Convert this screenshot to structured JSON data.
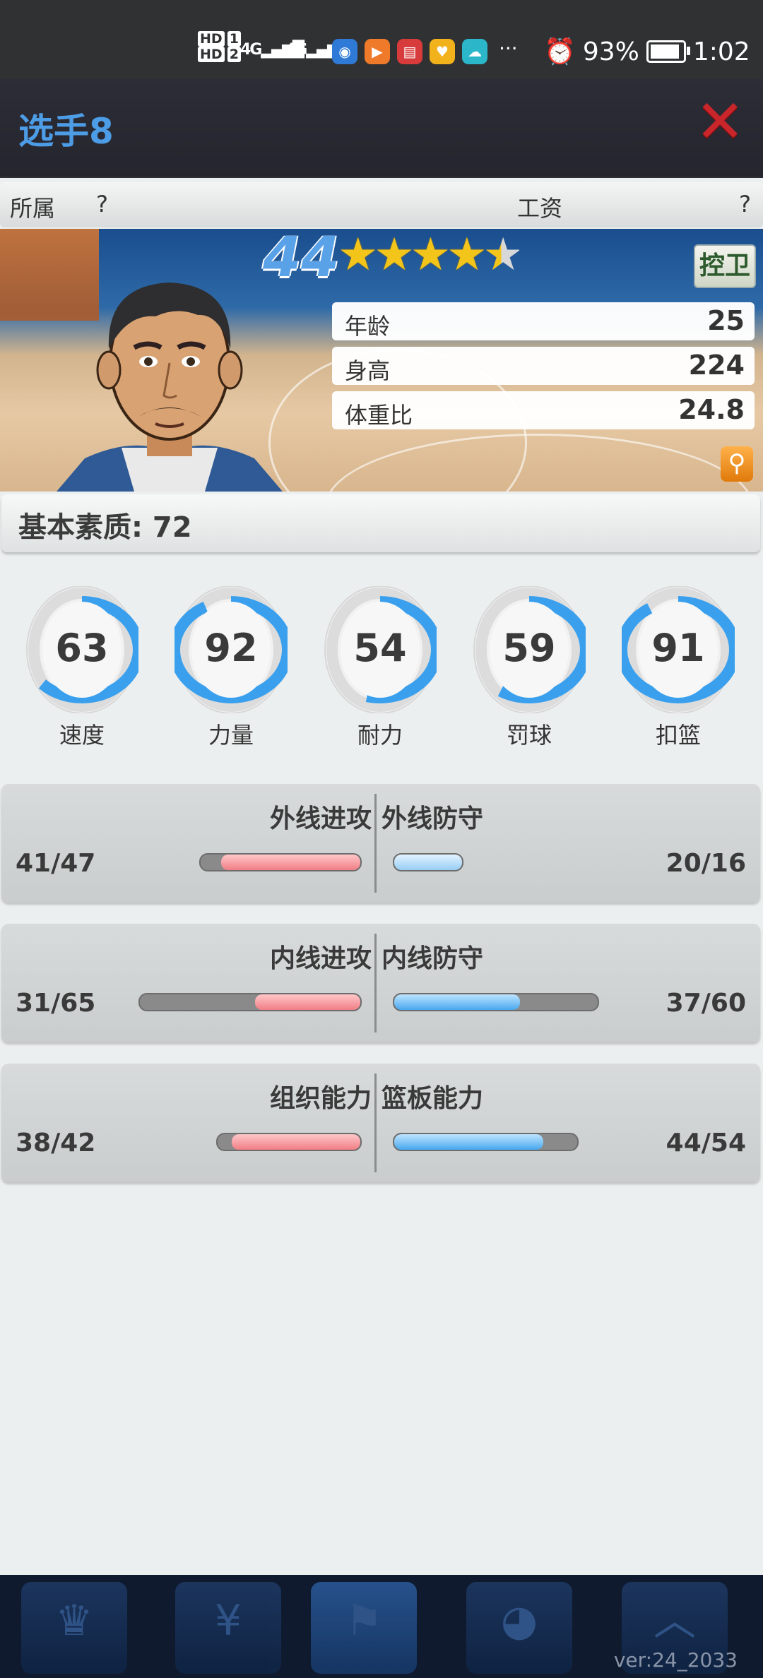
{
  "status_bar": {
    "hd1": "HD",
    "hd1_num": "1",
    "hd2": "HD",
    "hd2_num": "2",
    "network1": "4G",
    "network2": "4G",
    "more": "···",
    "battery_percent": "93%",
    "time": "1:02"
  },
  "header": {
    "title": "选手8",
    "close_icon": "close-x-icon"
  },
  "affiliation": {
    "affil_label": "所属",
    "affil_value": "?",
    "salary_label": "工资",
    "salary_value": "?"
  },
  "player": {
    "overall": "44",
    "stars": 4.5,
    "position": "控卫",
    "info": [
      {
        "label": "年龄",
        "value": "25"
      },
      {
        "label": "身高",
        "value": "224"
      },
      {
        "label": "体重比",
        "value": "24.8"
      }
    ]
  },
  "base_quality": "基本素质: 72",
  "attributes": [
    {
      "label": "速度",
      "value": "63"
    },
    {
      "label": "力量",
      "value": "92"
    },
    {
      "label": "耐力",
      "value": "54"
    },
    {
      "label": "罚球",
      "value": "59"
    },
    {
      "label": "扣篮",
      "value": "91"
    }
  ],
  "comparisons": [
    {
      "left_title": "外线进攻",
      "left_value": "41/47",
      "left_current": 41,
      "left_max": 47,
      "right_title": "外线防守",
      "right_value": "20/16",
      "right_current": 20,
      "right_max": 16
    },
    {
      "left_title": "内线进攻",
      "left_value": "31/65",
      "left_current": 31,
      "left_max": 65,
      "right_title": "内线防守",
      "right_value": "37/60",
      "right_current": 37,
      "right_max": 60
    },
    {
      "left_title": "组织能力",
      "left_value": "38/42",
      "left_current": 38,
      "left_max": 42,
      "right_title": "篮板能力",
      "right_value": "44/54",
      "right_current": 44,
      "right_max": 54
    }
  ],
  "version": "ver:24_2033",
  "colors": {
    "title_blue": "#4d9ce6",
    "gauge_blue": "#3aa0ee",
    "attack_red": "#f07e85",
    "defense_blue": "#48a8ef",
    "close_red": "#c8262a"
  }
}
